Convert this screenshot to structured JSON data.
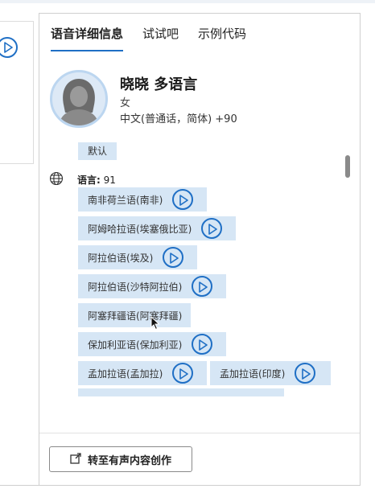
{
  "tabs": [
    {
      "label": "语音详细信息",
      "active": true
    },
    {
      "label": "试试吧",
      "active": false
    },
    {
      "label": "示例代码",
      "active": false
    }
  ],
  "voice": {
    "name": "晓晓 多语言",
    "gender": "女",
    "languages_summary": "中文(普通话，简体) +90"
  },
  "default_chip": "默认",
  "languages": {
    "label": "语言",
    "count": "91",
    "items": [
      {
        "label": "南非荷兰语(南非)"
      },
      {
        "label": "阿姆哈拉语(埃塞俄比亚)"
      },
      {
        "label": "阿拉伯语(埃及)"
      },
      {
        "label": "阿拉伯语(沙特阿拉伯)"
      },
      {
        "label": "阿塞拜疆语(阿塞拜疆)"
      },
      {
        "label": "保加利亚语(保加利亚)"
      },
      {
        "label": "孟加拉语(孟加拉)"
      },
      {
        "label": "孟加拉语(印度)"
      }
    ]
  },
  "cta": {
    "label": "转至有声内容创作",
    "icon": "external-link-icon"
  },
  "colors": {
    "accent": "#1f6fc5",
    "chip_bg": "#d6e6f5"
  }
}
